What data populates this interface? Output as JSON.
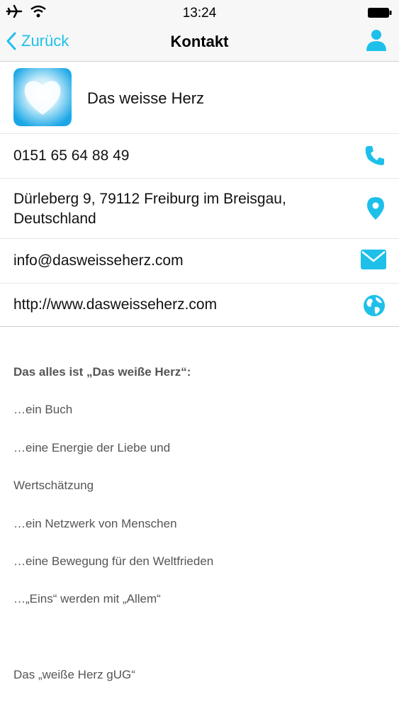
{
  "status_bar": {
    "time": "13:24"
  },
  "nav": {
    "back_label": "Zurück",
    "title": "Kontakt"
  },
  "contact": {
    "name": "Das weisse Herz",
    "phone": "0151 65 64 88 49",
    "address_line1": "Dürleberg 9, 79112 Freiburg im Breisgau,",
    "address_line2": "Deutschland",
    "email": "info@dasweisseherz.com",
    "website": "http://www.dasweisseherz.com"
  },
  "description": {
    "heading": "Das alles ist „Das weiße Herz“:",
    "lines": [
      "…ein Buch",
      "…eine Energie der Liebe und",
      "Wertschätzung",
      "…ein Netzwerk von Menschen",
      "…eine Bewegung für den Weltfrieden",
      "…„Eins“ werden mit „Allem“"
    ],
    "footer": "Das „weiße Herz gUG“"
  },
  "colors": {
    "accent": "#1ec0ea",
    "text": "#111111",
    "muted": "#555555"
  },
  "icons": [
    "airplane-icon",
    "wifi-icon",
    "battery-icon",
    "chevron-left-icon",
    "person-icon",
    "phone-icon",
    "map-pin-icon",
    "envelope-icon",
    "globe-icon"
  ]
}
